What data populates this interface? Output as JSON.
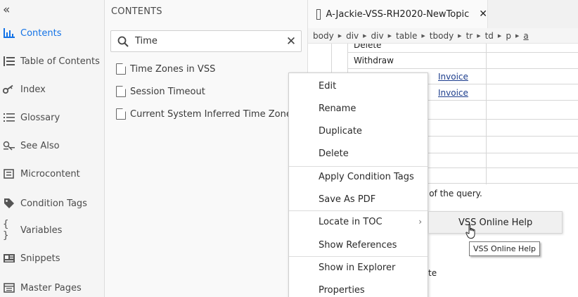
{
  "sidebar": {
    "collapse": "«",
    "items": [
      {
        "label": "Contents",
        "icon": "contents-icon"
      },
      {
        "label": "Table of Contents",
        "icon": "toc-icon"
      },
      {
        "label": "Index",
        "icon": "key-icon"
      },
      {
        "label": "Glossary",
        "icon": "glossary-icon"
      },
      {
        "label": "See Also",
        "icon": "see-also-icon"
      },
      {
        "label": "Microcontent",
        "icon": "microcontent-icon"
      },
      {
        "label": "Condition Tags",
        "icon": "tag-icon"
      },
      {
        "label": "Variables",
        "icon": "braces-icon"
      },
      {
        "label": "Snippets",
        "icon": "snippet-icon"
      },
      {
        "label": "Master Pages",
        "icon": "master-pages-icon"
      }
    ]
  },
  "contents": {
    "title": "CONTENTS",
    "search": {
      "value": "Time"
    },
    "results": [
      {
        "label": "Time Zones in VSS"
      },
      {
        "label": "Session Timeout"
      },
      {
        "label": "Current System Inferred Time Zone"
      }
    ]
  },
  "editor": {
    "tab": {
      "label": "A-Jackie-VSS-RH2020-NewTopic",
      "close": "✕"
    },
    "breadcrumb": [
      "body",
      "div",
      "div",
      "table",
      "tbody",
      "tr",
      "td",
      "p",
      "a"
    ],
    "content": {
      "delete_partial": "Delete",
      "withdraw": "Withdraw",
      "invoice1": "Invoice",
      "invoice2": "Invoice",
      "query_text": "e of the query.",
      "te_text": "te"
    }
  },
  "context_menu": {
    "items": [
      {
        "label": "Edit"
      },
      {
        "label": "Rename"
      },
      {
        "label": "Duplicate"
      },
      {
        "label": "Delete"
      },
      {
        "label": "Apply Condition Tags"
      },
      {
        "label": "Save As PDF"
      },
      {
        "label": "Locate in TOC",
        "submenu_arrow": "›"
      },
      {
        "label": "Show References"
      },
      {
        "label": "Show in Explorer"
      },
      {
        "label": "Properties"
      }
    ],
    "submenu": {
      "label": "VSS Online Help"
    },
    "tooltip": "VSS Online Help"
  },
  "colors": {
    "accent": "#1473e6",
    "link": "#1b3c8c"
  }
}
